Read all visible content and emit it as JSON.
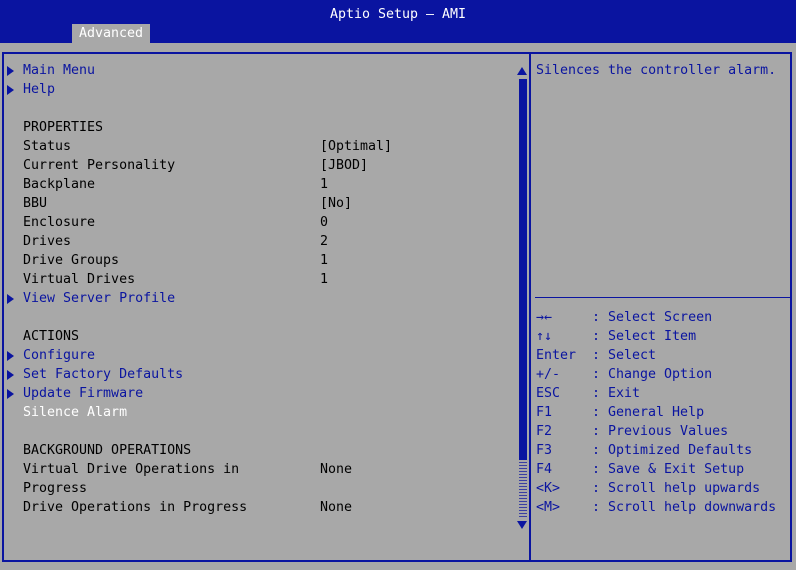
{
  "header": {
    "title": "Aptio Setup – AMI",
    "tab": "Advanced"
  },
  "menu": {
    "main_menu": "Main Menu",
    "help": "Help",
    "properties_header": "PROPERTIES",
    "status_label": "Status",
    "status_value": "[Optimal]",
    "personality_label": "Current Personality",
    "personality_value": "[JBOD]",
    "backplane_label": "Backplane",
    "backplane_value": "1",
    "bbu_label": "BBU",
    "bbu_value": "[No]",
    "enclosure_label": "Enclosure",
    "enclosure_value": "0",
    "drives_label": "Drives",
    "drives_value": "2",
    "drive_groups_label": "Drive Groups",
    "drive_groups_value": "1",
    "virtual_drives_label": "Virtual Drives",
    "virtual_drives_value": "1",
    "view_server_profile": "View Server Profile",
    "actions_header": "ACTIONS",
    "configure": "Configure",
    "set_factory_defaults": "Set Factory Defaults",
    "update_firmware": "Update Firmware",
    "silence_alarm": "Silence Alarm",
    "bg_ops_header": "BACKGROUND OPERATIONS",
    "vd_ops_label_1": "Virtual Drive Operations in",
    "vd_ops_label_2": "Progress",
    "vd_ops_value": "None",
    "drive_ops_label": "Drive Operations in Progress",
    "drive_ops_value": "None"
  },
  "help_panel": {
    "description": "Silences the controller alarm.",
    "keys": [
      {
        "key": "→←",
        "desc": ": Select Screen"
      },
      {
        "key": "↑↓",
        "desc": ": Select Item"
      },
      {
        "key": "Enter",
        "desc": ": Select"
      },
      {
        "key": "+/-",
        "desc": ": Change Option"
      },
      {
        "key": "ESC",
        "desc": ": Exit"
      },
      {
        "key": "F1",
        "desc": ": General Help"
      },
      {
        "key": "F2",
        "desc": ": Previous Values"
      },
      {
        "key": "F3",
        "desc": ": Optimized Defaults"
      },
      {
        "key": "F4",
        "desc": ": Save & Exit Setup"
      },
      {
        "key": "<K>",
        "desc": ": Scroll help upwards"
      },
      {
        "key": "<M>",
        "desc": ": Scroll help downwards"
      }
    ]
  },
  "colors": {
    "background": "#a8a8a8",
    "accent": "#0a14a0",
    "selected_text": "#ffffff"
  }
}
